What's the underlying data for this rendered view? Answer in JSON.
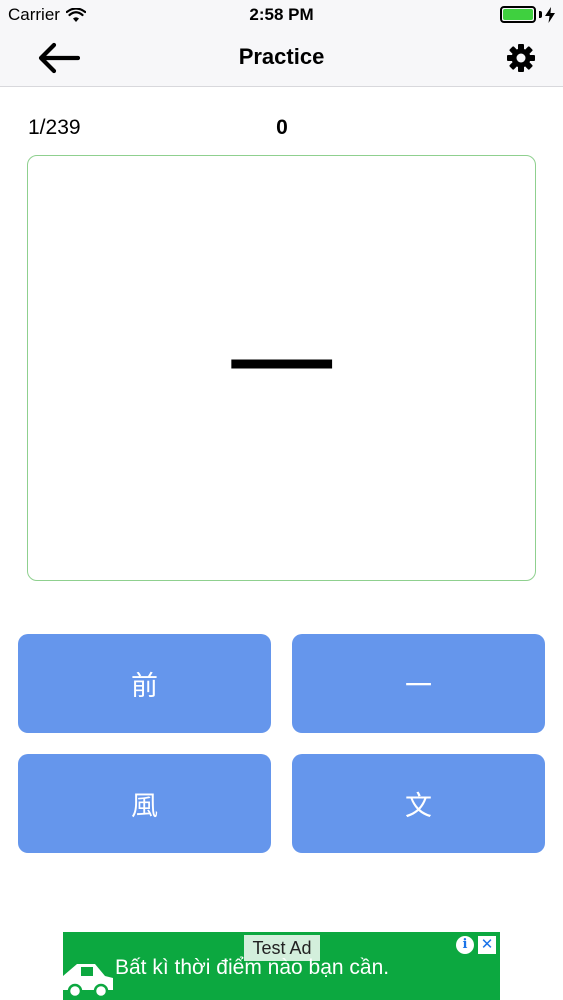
{
  "status": {
    "carrier": "Carrier",
    "time": "2:58 PM",
    "battery_level": 1.0
  },
  "nav": {
    "title": "Practice",
    "back_icon": "arrow-left-icon",
    "settings_icon": "gear-icon"
  },
  "quiz": {
    "progress": "1/239",
    "score": "0",
    "character": "一"
  },
  "answers": [
    "前",
    "一",
    "風",
    "文"
  ],
  "ad": {
    "label": "Test Ad",
    "text": "Bất kì thời điểm nào bạn cần."
  },
  "colors": {
    "answer_button": "#6596ec",
    "card_border": "#8fd08f",
    "ad_background": "#0ca840",
    "battery": "#3fd03f"
  }
}
